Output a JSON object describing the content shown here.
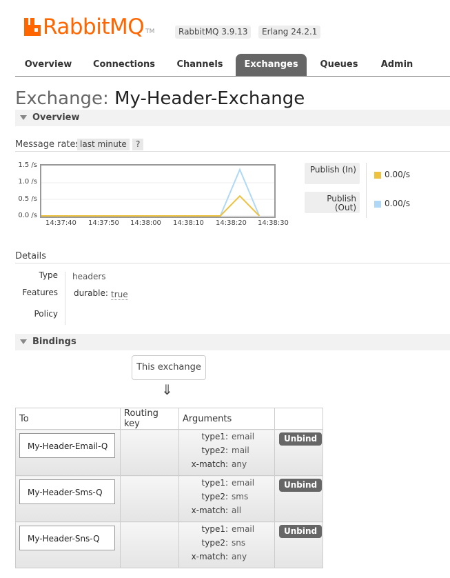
{
  "header": {
    "brand": "RabbitMQ",
    "trademark": "TM",
    "version": "RabbitMQ 3.9.13",
    "erlang": "Erlang 24.2.1",
    "brand_color": "#ff6600"
  },
  "tabs": [
    {
      "label": "Overview"
    },
    {
      "label": "Connections"
    },
    {
      "label": "Channels"
    },
    {
      "label": "Exchanges",
      "active": true
    },
    {
      "label": "Queues"
    },
    {
      "label": "Admin"
    }
  ],
  "page": {
    "title_prefix": "Exchange: ",
    "title_name": "My-Header-Exchange"
  },
  "overview": {
    "section_label": "Overview",
    "message_rates_label": "Message rates",
    "range_label": "last minute",
    "help_label": "?",
    "publish_in_label": "Publish (In)",
    "publish_in_value": "0.00/s",
    "publish_out_label": "Publish (Out)",
    "publish_out_value": "0.00/s",
    "colors": {
      "in": "#edc240",
      "out": "#afd8f8"
    }
  },
  "chart_data": {
    "type": "line",
    "x": [
      "14:37:40",
      "14:37:50",
      "14:38:00",
      "14:38:10",
      "14:38:20",
      "14:38:30"
    ],
    "ytick_labels": [
      "1.5 /s",
      "1.0 /s",
      "0.5 /s",
      "0.0 /s"
    ],
    "ylim": [
      0,
      1.5
    ],
    "xlim_seconds": [
      0,
      60
    ],
    "series": [
      {
        "name": "Publish (In)",
        "color": "#edc240",
        "points": [
          [
            0,
            0
          ],
          [
            46,
            0
          ],
          [
            51,
            0.6
          ],
          [
            56,
            0
          ]
        ]
      },
      {
        "name": "Publish (Out)",
        "color": "#afd8f8",
        "points": [
          [
            0,
            0
          ],
          [
            46,
            0
          ],
          [
            51,
            1.4
          ],
          [
            56,
            0
          ]
        ]
      }
    ]
  },
  "details": {
    "label": "Details",
    "type_key": "Type",
    "type_value": "headers",
    "features_key": "Features",
    "durable_key": "durable:",
    "durable_value": "true",
    "policy_key": "Policy"
  },
  "bindings": {
    "section_label": "Bindings",
    "this_exchange": "This exchange",
    "arrow": "⇓",
    "columns": [
      "To",
      "Routing key",
      "Arguments",
      ""
    ],
    "unbind_label": "Unbind",
    "rows": [
      {
        "to": "My-Header-Email-Q",
        "routing_key": "",
        "args": [
          {
            "k": "type1:",
            "v": "email"
          },
          {
            "k": "type2:",
            "v": "mail"
          },
          {
            "k": "x-match:",
            "v": "any"
          }
        ]
      },
      {
        "to": "My-Header-Sms-Q",
        "routing_key": "",
        "args": [
          {
            "k": "type1:",
            "v": "email"
          },
          {
            "k": "type2:",
            "v": "sms"
          },
          {
            "k": "x-match:",
            "v": "all"
          }
        ]
      },
      {
        "to": "My-Header-Sns-Q",
        "routing_key": "",
        "args": [
          {
            "k": "type1:",
            "v": "email"
          },
          {
            "k": "type2:",
            "v": "sns"
          },
          {
            "k": "x-match:",
            "v": "any"
          }
        ]
      }
    ]
  }
}
